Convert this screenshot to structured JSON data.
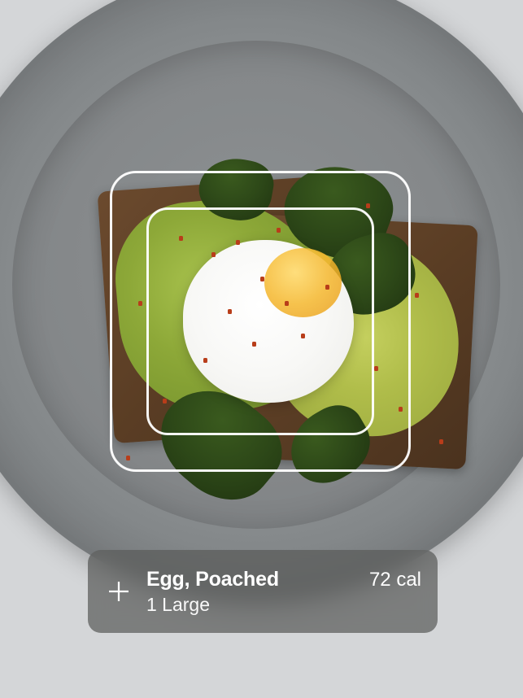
{
  "scan_result": {
    "food_name": "Egg, Poached",
    "calories_label": "72 cal",
    "serving_label": "1 Large"
  },
  "icons": {
    "add": "plus-icon"
  }
}
